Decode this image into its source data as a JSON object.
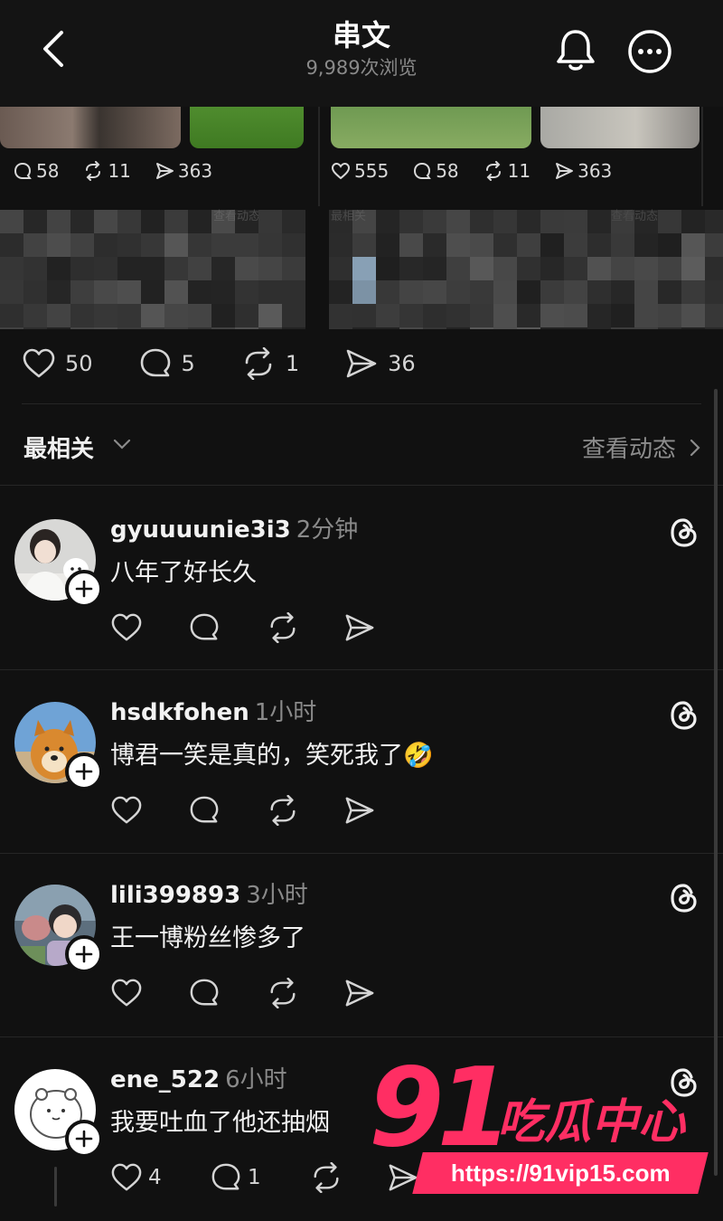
{
  "header": {
    "title": "串文",
    "subtitle": "9,989次浏览"
  },
  "top_cards": {
    "left": {
      "replies": "58",
      "reposts": "11",
      "shares": "363"
    },
    "right": {
      "likes": "555",
      "replies": "58",
      "reposts": "11",
      "shares": "363"
    },
    "faint_labels": [
      "查看动态",
      "最相关",
      "查看动态"
    ]
  },
  "post_stats": {
    "likes": "50",
    "replies": "5",
    "reposts": "1",
    "shares": "36"
  },
  "sort": {
    "label": "最相关",
    "view_activity": "查看动态"
  },
  "comments": [
    {
      "username": "gyuuuunie3i3",
      "time": "2分钟",
      "text": "八年了好长久"
    },
    {
      "username": "hsdkfohen",
      "time": "1小时",
      "text": "博君一笑是真的，笑死我了🤣"
    },
    {
      "username": "lili399893",
      "time": "3小时",
      "text": "王一博粉丝惨多了"
    },
    {
      "username": "ene_522",
      "time": "6小时",
      "text": "我要吐血了他还抽烟",
      "likes": "4",
      "replies": "1"
    }
  ],
  "watermark": {
    "number": "91",
    "name": "吃瓜中心",
    "url": "https://91vip15.com"
  },
  "colors": {
    "background": "#111111",
    "watermark": "#ff2e63",
    "muted": "#8a8a8a"
  }
}
